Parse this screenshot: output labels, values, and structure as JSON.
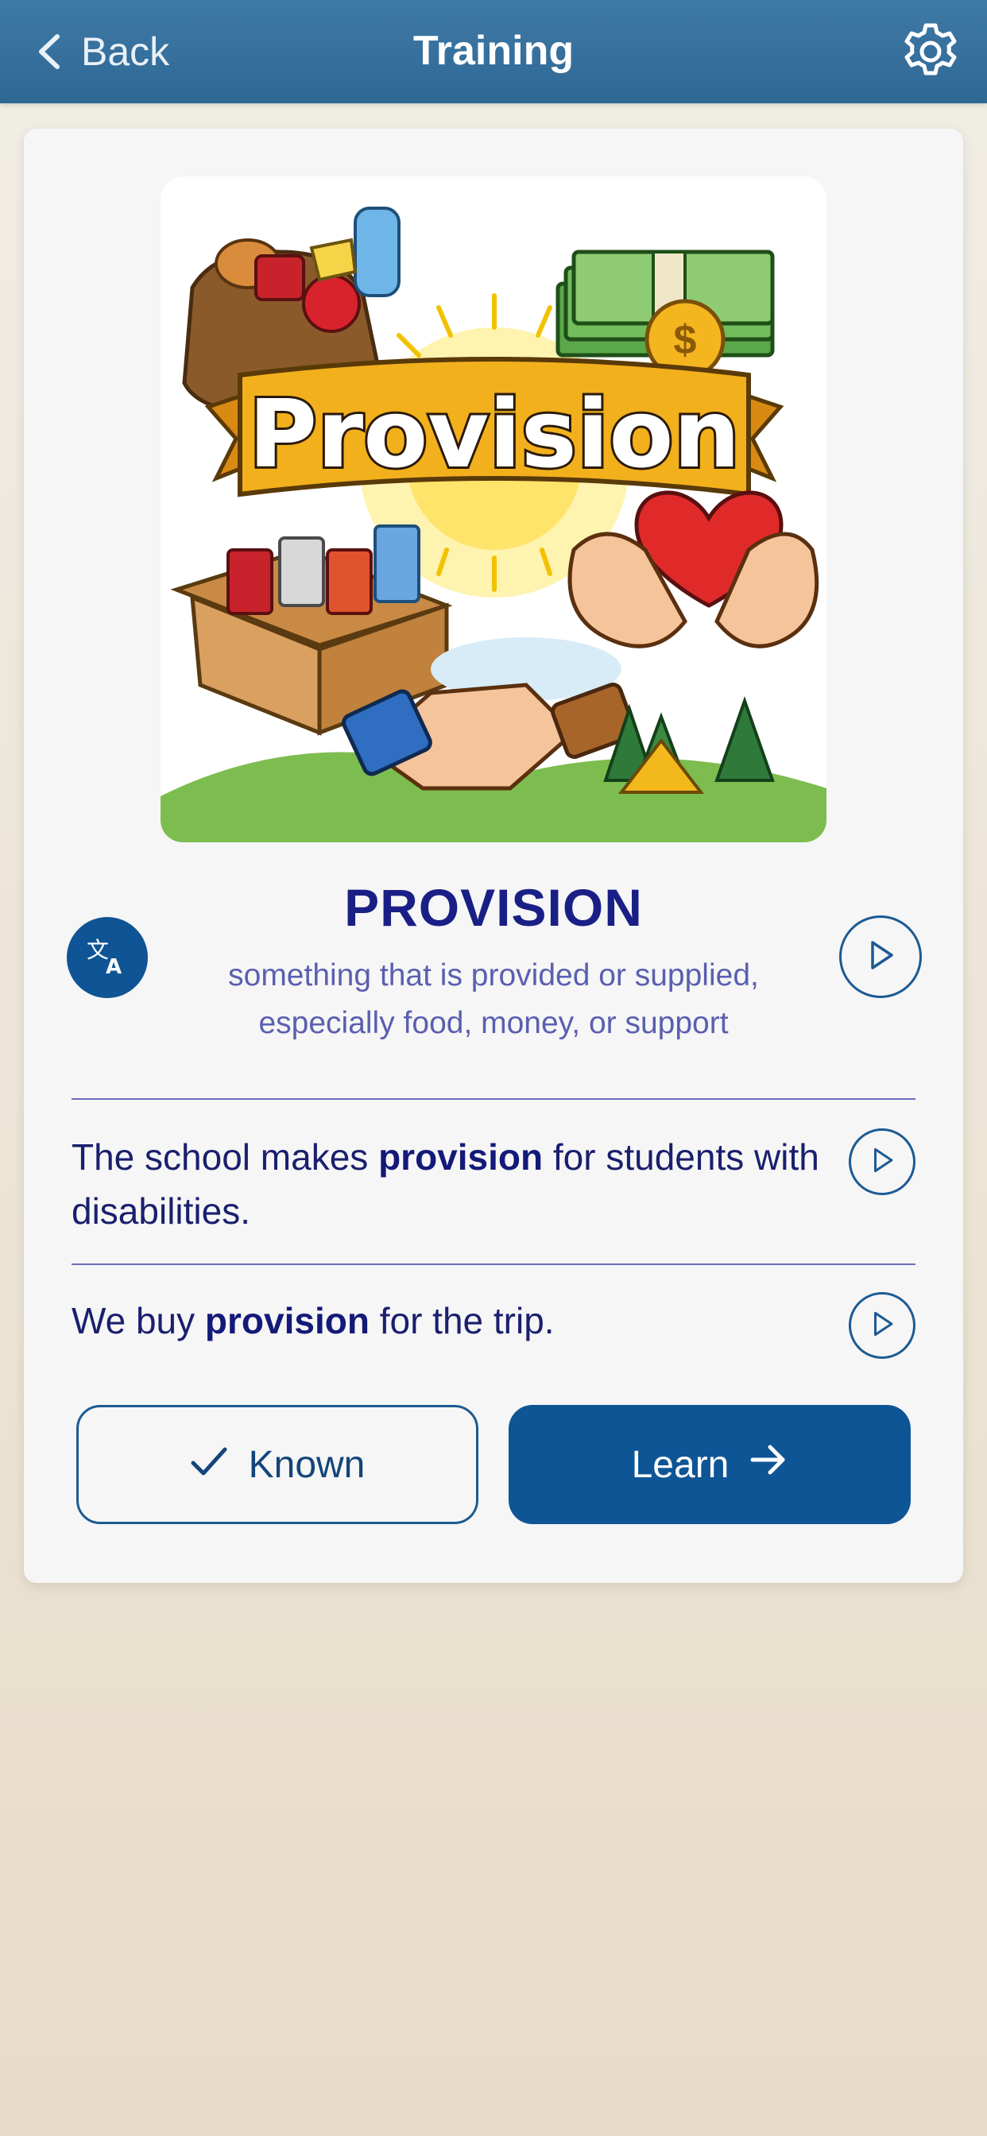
{
  "header": {
    "back_label": "Back",
    "title": "Training",
    "settings_icon": "gear-icon",
    "back_icon": "chevron-left-icon"
  },
  "card": {
    "image": {
      "banner_text": "Provision",
      "description_icon": "provision-illustration"
    },
    "word": "PROVISION",
    "definition": "something that is provided or supplied, especially food, money, or support",
    "translate_icon": "translate-icon",
    "play_icon": "play-icon",
    "examples": [
      {
        "before": "The school makes ",
        "bold": "provision",
        "after": " for students with disabilities."
      },
      {
        "before": "We buy ",
        "bold": "provision",
        "after": " for the trip."
      }
    ],
    "buttons": {
      "known_label": "Known",
      "learn_label": "Learn"
    }
  },
  "colors": {
    "header_bg": "#3a739f",
    "primary": "#0e5596",
    "word": "#1a1f86",
    "definition": "#5b5fb0"
  }
}
